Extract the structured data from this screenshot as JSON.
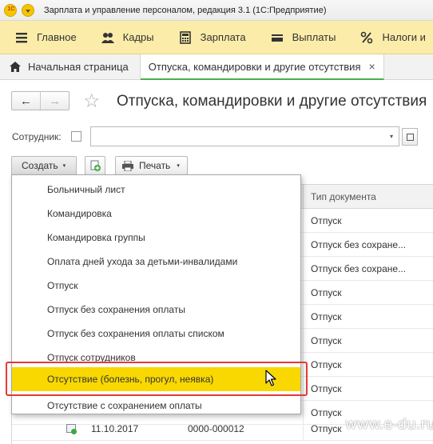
{
  "titlebar": {
    "title": "Зарплата и управление персоналом, редакция 3.1  (1С:Предприятие)"
  },
  "sections": [
    {
      "label": "Главное",
      "icon": "hamburger-icon"
    },
    {
      "label": "Кадры",
      "icon": "people-icon"
    },
    {
      "label": "Зарплата",
      "icon": "calculator-icon"
    },
    {
      "label": "Выплаты",
      "icon": "wallet-icon"
    },
    {
      "label": "Налоги и",
      "icon": "percent-icon"
    }
  ],
  "tabs": {
    "home": "Начальная страница",
    "active": "Отпуска, командировки и другие отсутствия",
    "close": "×"
  },
  "form": {
    "title": "Отпуска, командировки и другие отсутствия",
    "back": "←",
    "forward": "→",
    "star": "☆"
  },
  "filter": {
    "employee_label": "Сотрудник:",
    "employee_value": ""
  },
  "toolbar": {
    "create_label": "Создать",
    "print_label": "Печать",
    "dropdown_arrow": "▾"
  },
  "table": {
    "header_doctype": "Тип документа",
    "rows": [
      {
        "type": "Отпуск"
      },
      {
        "type": "Отпуск без сохране..."
      },
      {
        "type": "Отпуск без сохране..."
      },
      {
        "type": "Отпуск"
      },
      {
        "type": "Отпуск"
      },
      {
        "type": "Отпуск"
      },
      {
        "type": "Отпуск"
      },
      {
        "type": "Отпуск"
      },
      {
        "type": "Отпуск"
      },
      {
        "type": "Отпуск",
        "date": "11.10.2017",
        "number": "0000-000012"
      }
    ]
  },
  "create_menu": {
    "items": [
      "Больничный лист",
      "Командировка",
      "Командировка группы",
      "Оплата дней ухода за детьми-инвалидами",
      "Отпуск",
      "Отпуск без сохранения оплаты",
      "Отпуск без сохранения оплаты списком",
      "Отпуск сотрудников",
      "Отсутствие (болезнь, прогул, неявка)",
      "Отсутствие с сохранением оплаты"
    ],
    "highlighted_index": 8,
    "highlight_color": "#f8d800"
  },
  "watermark": "www.e-du.ru",
  "colors": {
    "section_panel": "#fbeca9",
    "active_tab_underline": "#4cae4c",
    "annotation_frame": "#e53935"
  }
}
